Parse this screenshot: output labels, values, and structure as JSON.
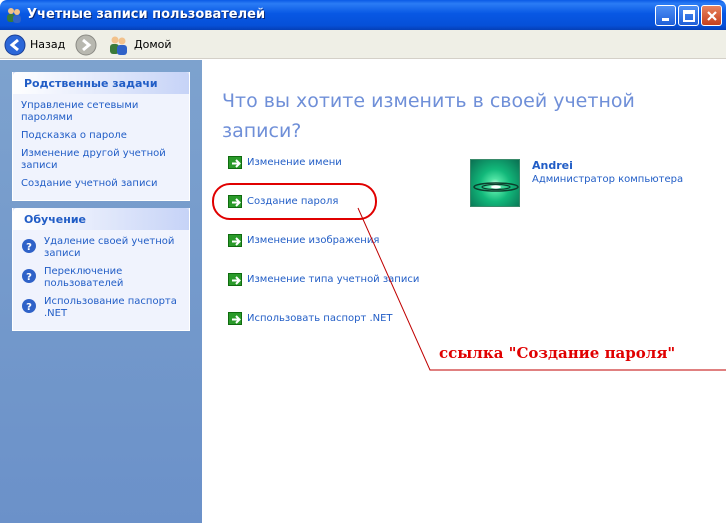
{
  "window": {
    "title": "Учетные записи пользователей"
  },
  "toolbar": {
    "back_label": "Назад",
    "home_label": "Домой"
  },
  "sidebar": {
    "related": {
      "header": "Родственные задачи",
      "links": [
        "Управление сетевыми паролями",
        "Подсказка о пароле",
        "Изменение другой учетной записи",
        "Создание учетной записи"
      ]
    },
    "learn": {
      "header": "Обучение",
      "items": [
        "Удаление своей учетной записи",
        "Переключение пользователей",
        "Использование паспорта .NET"
      ]
    }
  },
  "main": {
    "heading": "Что вы хотите изменить в своей учетной записи?",
    "actions": [
      "Изменение имени",
      "Создание пароля",
      "Изменение изображения",
      "Изменение типа учетной записи",
      "Использовать паспорт .NET"
    ],
    "user": {
      "name": "Andrei",
      "role": "Администратор компьютера"
    }
  },
  "annotation": {
    "text": "ссылка \"Создание пароля\"",
    "color": "#e00000"
  },
  "colors": {
    "titlebar": "#0858e4",
    "link": "#215dc6",
    "heading": "#6f8fd8",
    "sidebar_bg": "#7da2ce"
  }
}
